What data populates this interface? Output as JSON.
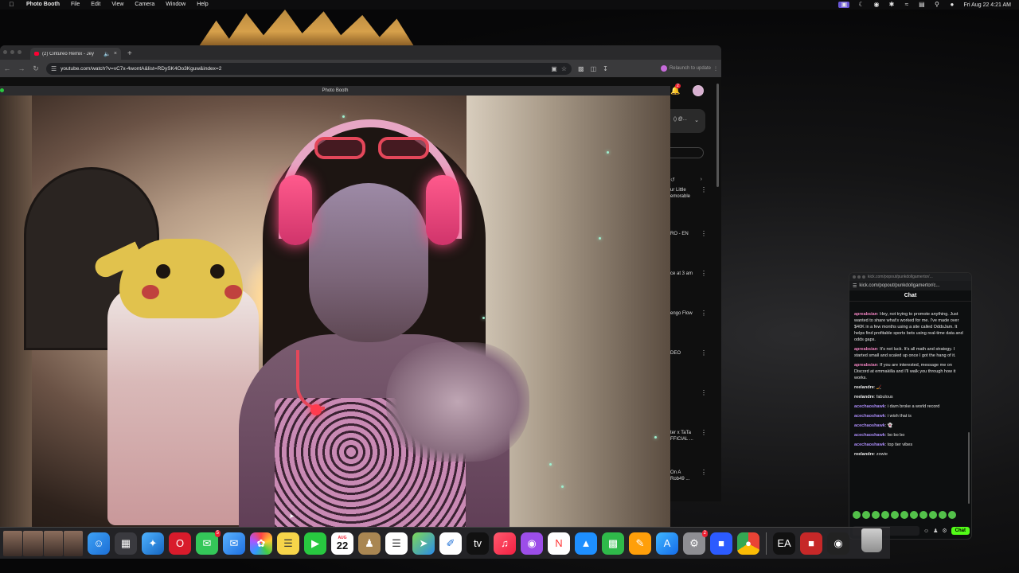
{
  "menubar": {
    "app_name": "Photo Booth",
    "menus": [
      "File",
      "Edit",
      "View",
      "Camera",
      "Window",
      "Help"
    ],
    "datetime": "Fri Aug 22  4:21 AM"
  },
  "chrome": {
    "tab_title": "(2) Cintureo Remix - Jey",
    "url": "youtube.com/watch?v=vC7x-4wontA&list=RDySK4Oo3Kguw&index=2",
    "relaunch_label": "Relaunch to update",
    "bell_count": "2"
  },
  "youtube_sidebar": {
    "playlist_label": "() @...",
    "items": [
      {
        "text": "ur Little\nemorable"
      },
      {
        "text": "RO - EN"
      },
      {
        "text": "ce at 3 am"
      },
      {
        "text": "engo Flow"
      },
      {
        "text": "DEO"
      },
      {
        "text": ""
      },
      {
        "text": "ter x TaTa\nFFICIAL ..."
      },
      {
        "text": "On A\nRob49 ..."
      }
    ]
  },
  "photobooth": {
    "window_title": "Photo Booth"
  },
  "chat": {
    "window_url": "kick.com/popout/punkdollgamertor/...",
    "address": "kick.com/popout/punkdollgamertor/c...",
    "header": "Chat",
    "messages": [
      {
        "user": "apreabsian",
        "text": "Hey, not trying to promote anything. Just wanted to share what's worked for me. I've made over $40K in a few months using a site called OddsJam. It helps find profitable sports bets using real-time data and odds gaps.",
        "color": "pink"
      },
      {
        "user": "apreabsian",
        "text": "It's not luck. It's all math and strategy. I started small and scaled up once I got the hang of it.",
        "color": "pink"
      },
      {
        "user": "apreabsian",
        "text": "If you are interested, message me on Discord at emmakilla and I'll walk you through how it works.",
        "color": "pink"
      },
      {
        "user": "reelandre",
        "text": "🏒",
        "color": "white"
      },
      {
        "user": "reelandre",
        "text": "fabulous",
        "color": "white"
      },
      {
        "user": "acechaoshawk",
        "text": "i darn broke a world record",
        "color": "purple"
      },
      {
        "user": "acechaoshawk",
        "text": "i wish that is",
        "color": "purple"
      },
      {
        "user": "acechaoshawk",
        "text": "👻",
        "color": "purple"
      },
      {
        "user": "acechaoshawk",
        "text": "bo bo bo",
        "color": "purple"
      },
      {
        "user": "acechaoshawk",
        "text": "top tier vibes",
        "color": "purple"
      },
      {
        "user": "reelandre",
        "text": "zowie",
        "color": "white"
      }
    ],
    "send_label": "Chat"
  },
  "dock": {
    "calendar_month": "AUG",
    "calendar_day": "22",
    "messages_badge": "5",
    "settings_badge": "2"
  }
}
